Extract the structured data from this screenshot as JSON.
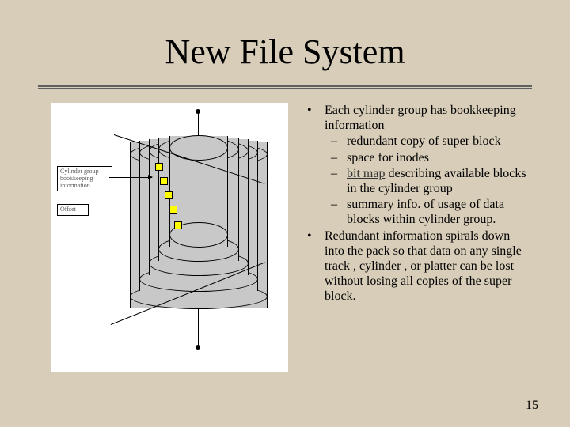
{
  "title": "New File System",
  "figure": {
    "label1_line1": "Cylinder group",
    "label1_line2": "bookkeeping",
    "label1_line3": "information",
    "label2": "Offset"
  },
  "bullets": [
    {
      "text": "Each cylinder group has bookkeeping information",
      "subs": [
        {
          "text": "redundant copy of super block"
        },
        {
          "text": "space for inodes"
        },
        {
          "pre": "bit map",
          "post": " describing available blocks in the cylinder group",
          "underline": true
        },
        {
          "text": "summary info. of usage of data blocks within cylinder group."
        }
      ]
    },
    {
      "text": "Redundant information spirals down into the pack so that data on any single track , cylinder , or platter can be lost without losing all copies of the super block."
    }
  ],
  "page": "15"
}
